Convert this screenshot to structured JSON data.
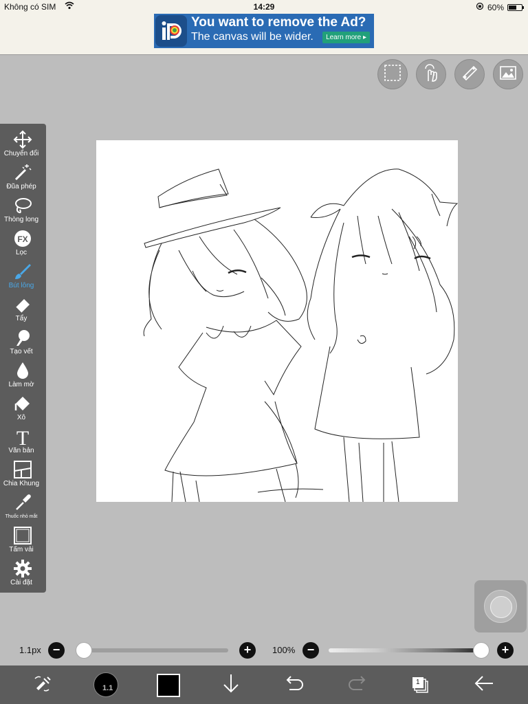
{
  "status": {
    "carrier": "Không có SIM",
    "time": "14:29",
    "battery_percent": "60%",
    "battery_level": 0.6
  },
  "ad": {
    "headline": "You want to remove the Ad?",
    "subline": "The canvas will be wider.",
    "cta": "Learn more ▸"
  },
  "top_buttons": [
    {
      "icon": "selection-icon"
    },
    {
      "icon": "touch-hand-icon"
    },
    {
      "icon": "ruler-icon"
    },
    {
      "icon": "image-icon"
    }
  ],
  "tools": [
    {
      "label": "Chuyển đổi",
      "icon": "move-arrows-icon",
      "active": false
    },
    {
      "label": "Đũa phép",
      "icon": "magic-wand-icon",
      "active": false
    },
    {
      "label": "Thòng long",
      "icon": "lasso-icon",
      "active": false
    },
    {
      "label": "Lọc",
      "icon": "fx-filter-icon",
      "active": false
    },
    {
      "label": "Bút lông",
      "icon": "brush-icon",
      "active": true
    },
    {
      "label": "Tẩy",
      "icon": "eraser-icon",
      "active": false
    },
    {
      "label": "Tạo vết",
      "icon": "smudge-icon",
      "active": false
    },
    {
      "label": "Làm mờ",
      "icon": "blur-drop-icon",
      "active": false
    },
    {
      "label": "Xô",
      "icon": "bucket-icon",
      "active": false
    },
    {
      "label": "Văn bản",
      "icon": "text-icon",
      "active": false
    },
    {
      "label": "Chia Khung",
      "icon": "frame-divide-icon",
      "active": false
    },
    {
      "label": "Thuốc nhỏ mắt",
      "icon": "eyedropper-icon",
      "active": false
    },
    {
      "label": "Tấm vải",
      "icon": "canvas-icon",
      "active": false
    },
    {
      "label": "Cài đặt",
      "icon": "gear-icon",
      "active": false
    }
  ],
  "brush_size": {
    "label": "1.1px",
    "minus": "−",
    "plus": "+",
    "level": 0.0
  },
  "opacity": {
    "label": "100%",
    "minus": "−",
    "plus": "+",
    "level": 1.0
  },
  "bottom": {
    "brush_size_value": "1.1",
    "layer_count": "1",
    "color": "#000000"
  },
  "colors": {
    "active_tool": "#4aa8e8",
    "toolbar": "#5c5c5c",
    "workspace": "#bdbdbd"
  }
}
